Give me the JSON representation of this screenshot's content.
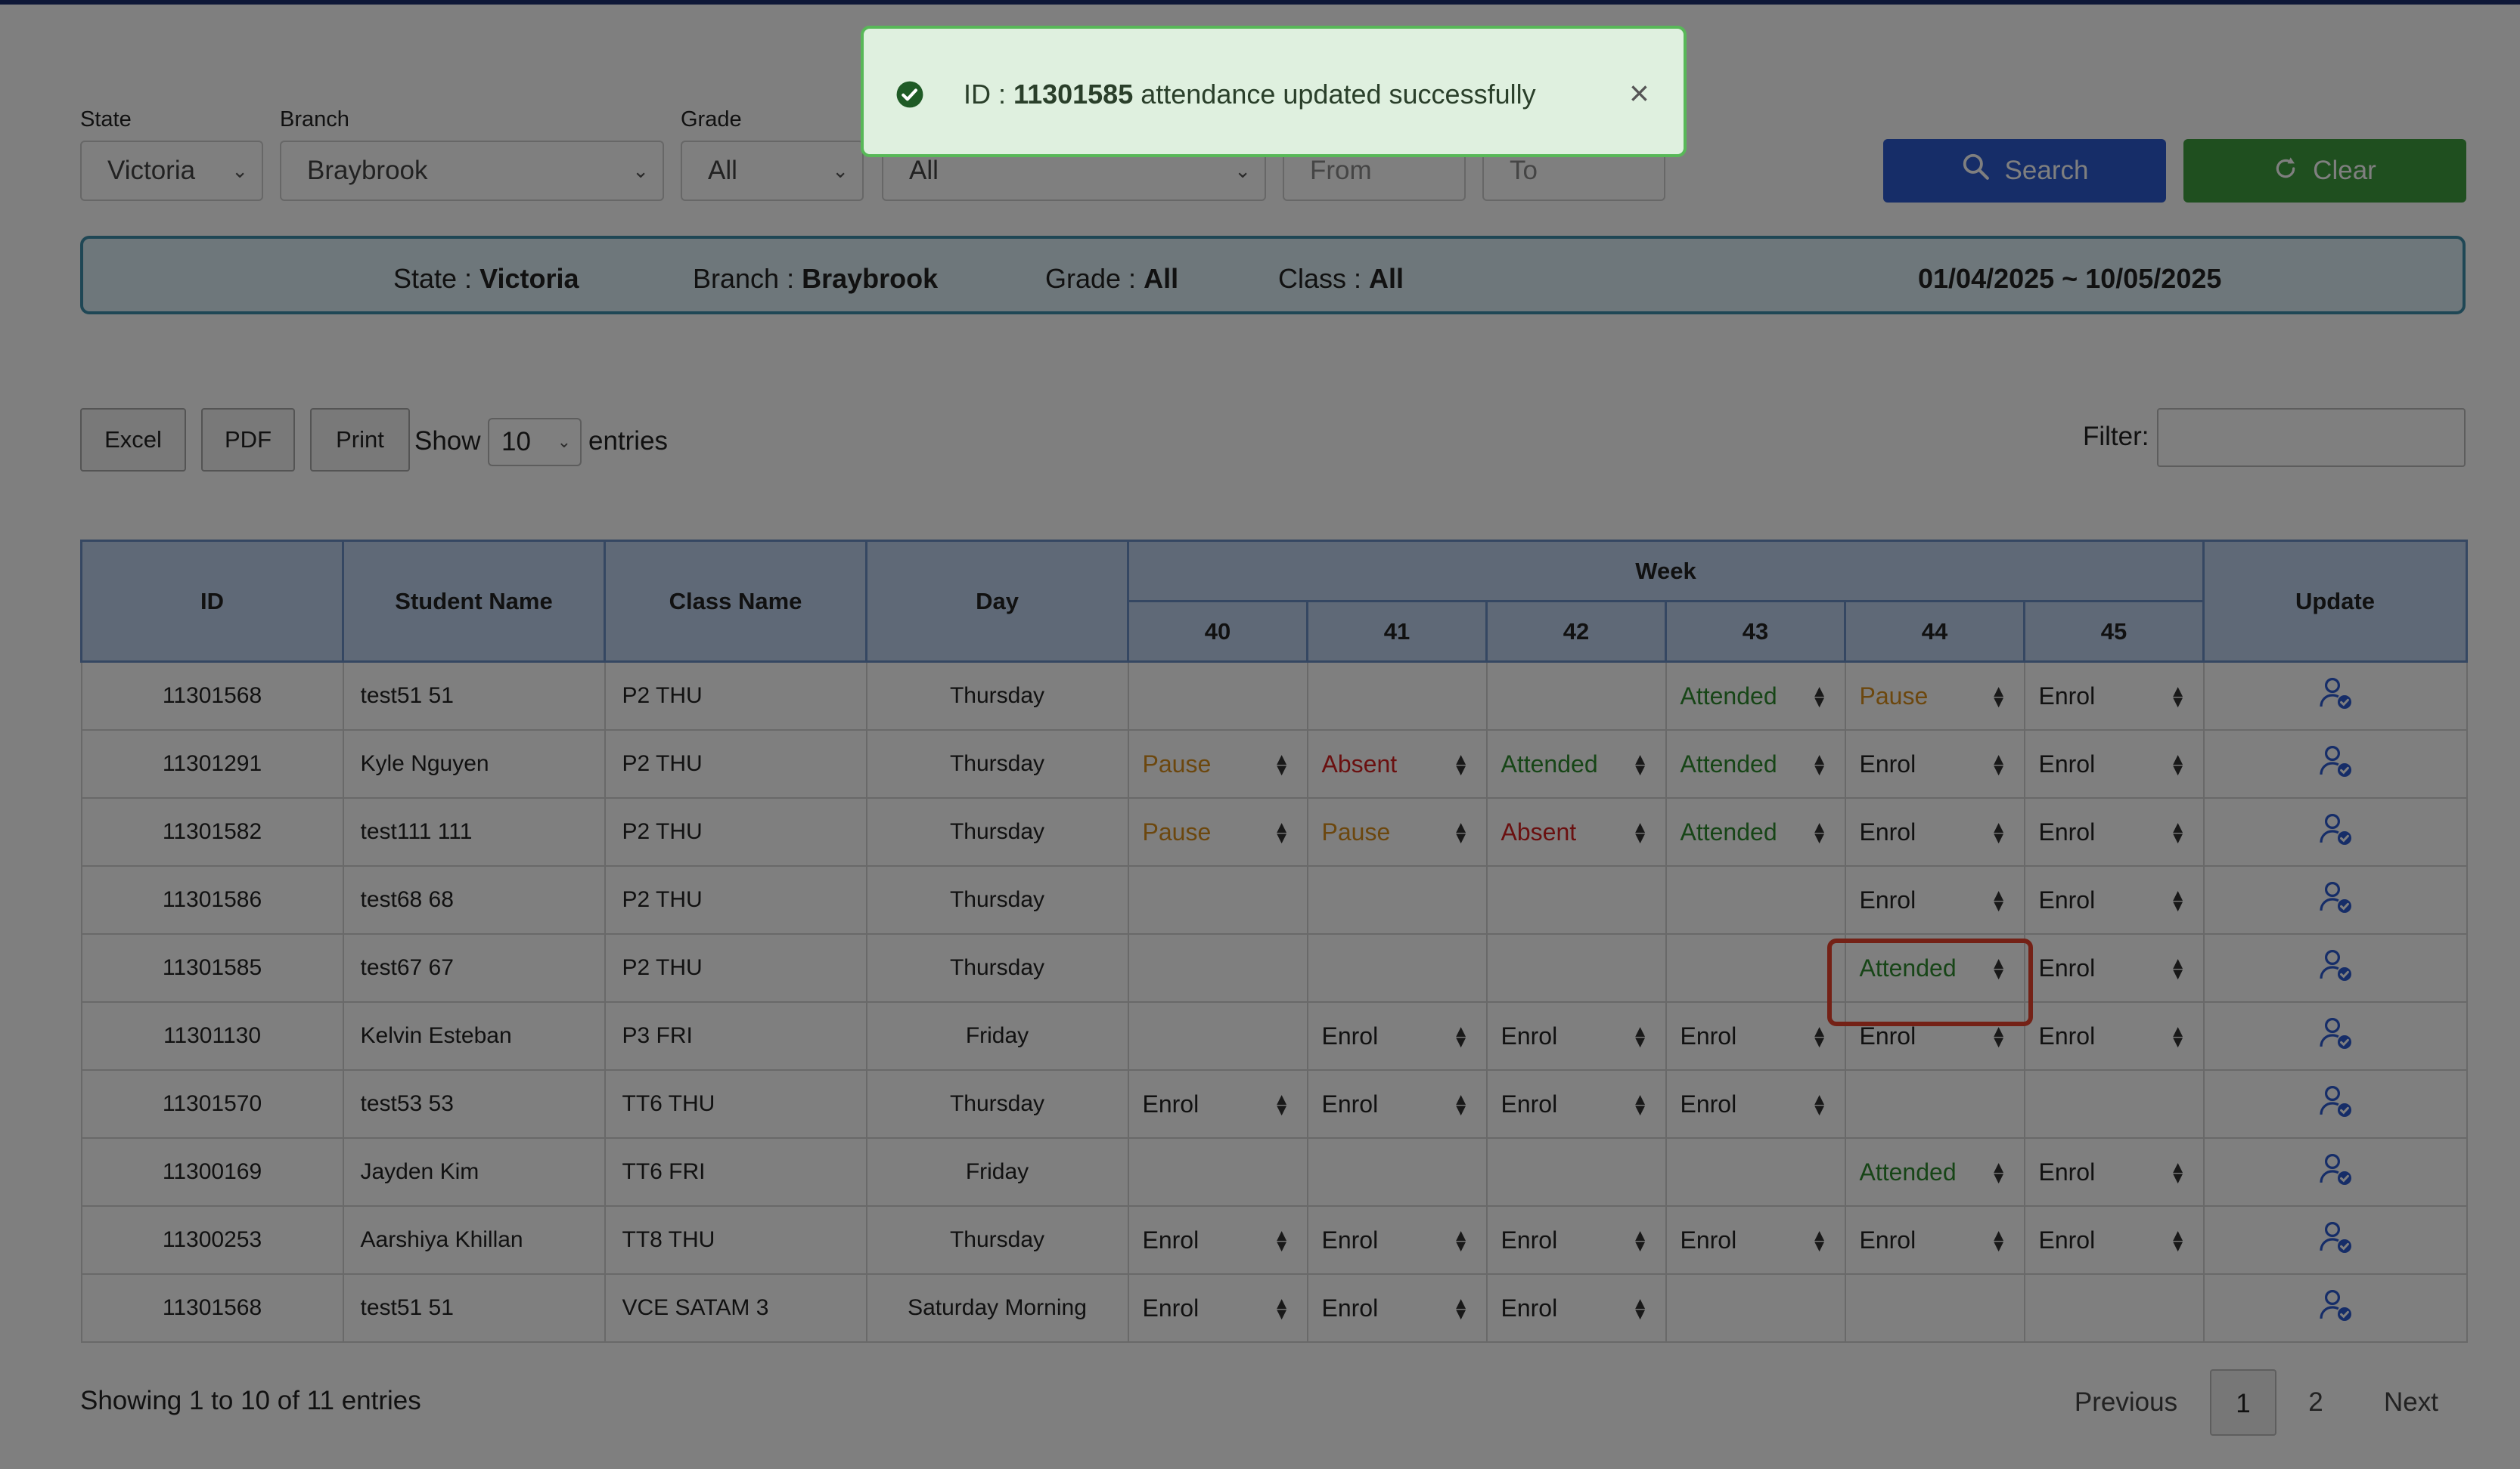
{
  "filters": {
    "state": {
      "label": "State",
      "value": "Victoria"
    },
    "branch": {
      "label": "Branch",
      "value": "Braybrook"
    },
    "grade": {
      "label": "Grade",
      "value": "All"
    },
    "class": {
      "value": "All"
    },
    "from": {
      "placeholder": "From"
    },
    "to": {
      "placeholder": "To"
    },
    "search_label": "Search",
    "clear_label": "Clear"
  },
  "summary": {
    "state_label": "State :",
    "state_value": "Victoria",
    "branch_label": "Branch :",
    "branch_value": "Braybrook",
    "grade_label": "Grade :",
    "grade_value": "All",
    "class_label": "Class :",
    "class_value": "All",
    "date_range": "01/04/2025 ~ 10/05/2025"
  },
  "toolbar": {
    "excel": "Excel",
    "pdf": "PDF",
    "print": "Print",
    "show": "Show",
    "entries_per_page": "10",
    "entries": "entries",
    "filter_label": "Filter:"
  },
  "table": {
    "headers": {
      "id": "ID",
      "student_name": "Student Name",
      "class_name": "Class Name",
      "day": "Day",
      "week": "Week",
      "update": "Update"
    },
    "weeks": [
      "40",
      "41",
      "42",
      "43",
      "44",
      "45"
    ],
    "rows": [
      {
        "id": "11301568",
        "name": "test51 51",
        "class": "P2 THU",
        "day": "Thursday",
        "weeks": [
          "",
          "",
          "",
          "Attended",
          "Pause",
          "Enrol"
        ]
      },
      {
        "id": "11301291",
        "name": "Kyle Nguyen",
        "class": "P2 THU",
        "day": "Thursday",
        "weeks": [
          "Pause",
          "Absent",
          "Attended",
          "Attended",
          "Enrol",
          "Enrol"
        ]
      },
      {
        "id": "11301582",
        "name": "test111 111",
        "class": "P2 THU",
        "day": "Thursday",
        "weeks": [
          "Pause",
          "Pause",
          "Absent",
          "Attended",
          "Enrol",
          "Enrol"
        ]
      },
      {
        "id": "11301586",
        "name": "test68 68",
        "class": "P2 THU",
        "day": "Thursday",
        "weeks": [
          "",
          "",
          "",
          "",
          "Enrol",
          "Enrol"
        ]
      },
      {
        "id": "11301585",
        "name": "test67 67",
        "class": "P2 THU",
        "day": "Thursday",
        "weeks": [
          "",
          "",
          "",
          "",
          "Attended",
          "Enrol"
        ]
      },
      {
        "id": "11301130",
        "name": "Kelvin Esteban",
        "class": "P3 FRI",
        "day": "Friday",
        "weeks": [
          "",
          "Enrol",
          "Enrol",
          "Enrol",
          "Enrol",
          "Enrol"
        ]
      },
      {
        "id": "11301570",
        "name": "test53 53",
        "class": "TT6 THU",
        "day": "Thursday",
        "weeks": [
          "Enrol",
          "Enrol",
          "Enrol",
          "Enrol",
          "",
          ""
        ]
      },
      {
        "id": "11300169",
        "name": "Jayden Kim",
        "class": "TT6 FRI",
        "day": "Friday",
        "weeks": [
          "",
          "",
          "",
          "",
          "Attended",
          "Enrol"
        ]
      },
      {
        "id": "11300253",
        "name": "Aarshiya Khillan",
        "class": "TT8 THU",
        "day": "Thursday",
        "weeks": [
          "Enrol",
          "Enrol",
          "Enrol",
          "Enrol",
          "Enrol",
          "Enrol"
        ]
      },
      {
        "id": "11301568",
        "name": "test51 51",
        "class": "VCE SATAM 3",
        "day": "Saturday Morning",
        "weeks": [
          "Enrol",
          "Enrol",
          "Enrol",
          "",
          "",
          ""
        ]
      }
    ],
    "status_colors": {
      "Attended": "#2e8b2e",
      "Pause": "#d98e1c",
      "Absent": "#d42020",
      "Enrol": "#222222"
    }
  },
  "footer": {
    "showing": "Showing 1 to 10 of 11 entries",
    "previous": "Previous",
    "pages": [
      "1",
      "2"
    ],
    "current_page": "1",
    "next": "Next"
  },
  "toast": {
    "prefix": "ID :",
    "id": "11301585",
    "message": "attendance updated successfully",
    "icon": "check-circle-icon"
  },
  "colors": {
    "primary": "#2c5ad0",
    "success": "#3f9f3f",
    "highlight": "#e8432c",
    "header_bg": "#bfd3ef",
    "summary_border": "#3f8faa"
  }
}
